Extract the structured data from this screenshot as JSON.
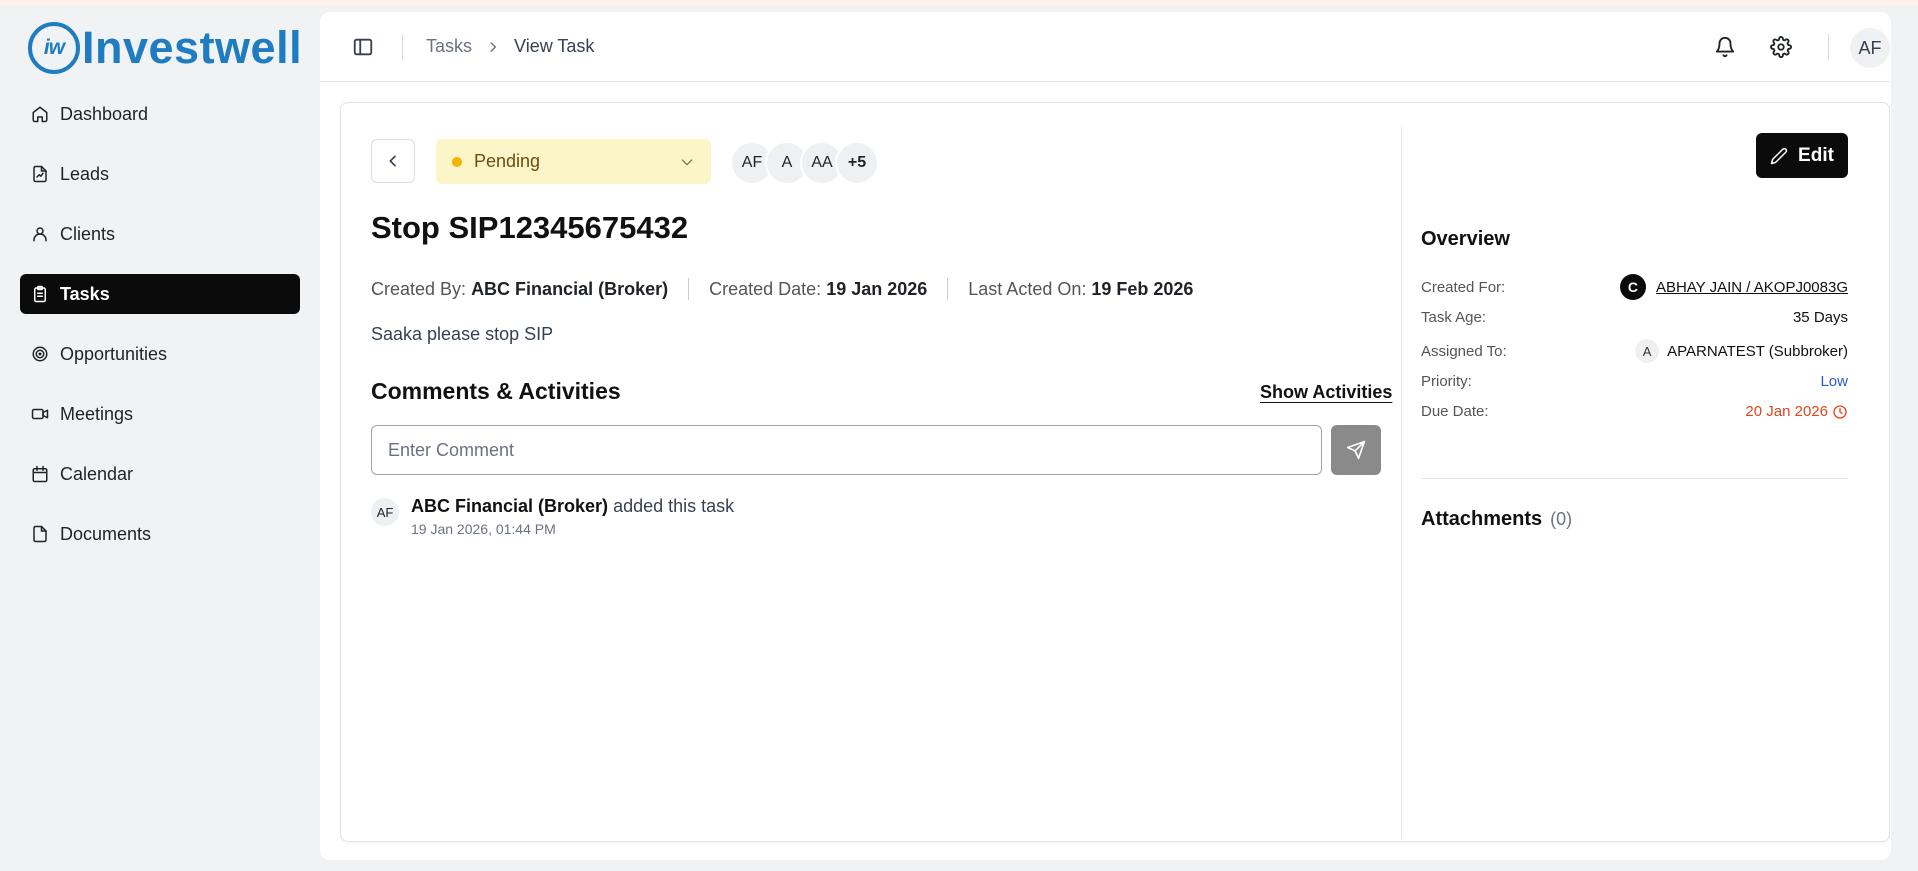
{
  "brand": {
    "logo_mark": "iw",
    "name": "Investwell",
    "color": "#1d7cc2"
  },
  "sidebar": {
    "items": [
      {
        "label": "Dashboard",
        "icon": "home-icon",
        "active": false
      },
      {
        "label": "Leads",
        "icon": "file-chart-icon",
        "active": false
      },
      {
        "label": "Clients",
        "icon": "user-icon",
        "active": false
      },
      {
        "label": "Tasks",
        "icon": "clipboard-list-icon",
        "active": true
      },
      {
        "label": "Opportunities",
        "icon": "target-icon",
        "active": false
      },
      {
        "label": "Meetings",
        "icon": "video-icon",
        "active": false
      },
      {
        "label": "Calendar",
        "icon": "calendar-icon",
        "active": false
      },
      {
        "label": "Documents",
        "icon": "document-icon",
        "active": false
      }
    ]
  },
  "header": {
    "breadcrumb": {
      "parent": "Tasks",
      "current": "View Task"
    },
    "user_initials": "AF"
  },
  "task": {
    "status": "Pending",
    "status_color": "#f4b400",
    "assignees": [
      "AF",
      "A",
      "AA"
    ],
    "assignees_more": "+5",
    "title": "Stop SIP12345675432",
    "created_by_label": "Created By:",
    "created_by": "ABC Financial (Broker)",
    "created_date_label": "Created Date:",
    "created_date": "19 Jan 2026",
    "last_acted_label": "Last Acted On:",
    "last_acted": "19 Feb 2026",
    "description": "Saaka please stop SIP"
  },
  "comments": {
    "title": "Comments & Activities",
    "show_activities": "Show Activities",
    "input_placeholder": "Enter Comment",
    "activity": {
      "avatar": "AF",
      "actor": "ABC Financial (Broker)",
      "action": "added this task",
      "time": "19 Jan 2026, 01:44 PM"
    }
  },
  "overview": {
    "edit_label": "Edit",
    "title": "Overview",
    "created_for_label": "Created For:",
    "created_for_badge": "C",
    "created_for": "ABHAY JAIN / AKOPJ0083G",
    "task_age_label": "Task Age:",
    "task_age": "35 Days",
    "assigned_to_label": "Assigned To:",
    "assigned_to_badge": "A",
    "assigned_to": "APARNATEST (Subbroker)",
    "priority_label": "Priority:",
    "priority": "Low",
    "priority_color": "#2a5bd7",
    "due_date_label": "Due Date:",
    "due_date": "20 Jan 2026",
    "due_color": "#e0461c"
  },
  "attachments": {
    "title": "Attachments",
    "count": "(0)"
  }
}
